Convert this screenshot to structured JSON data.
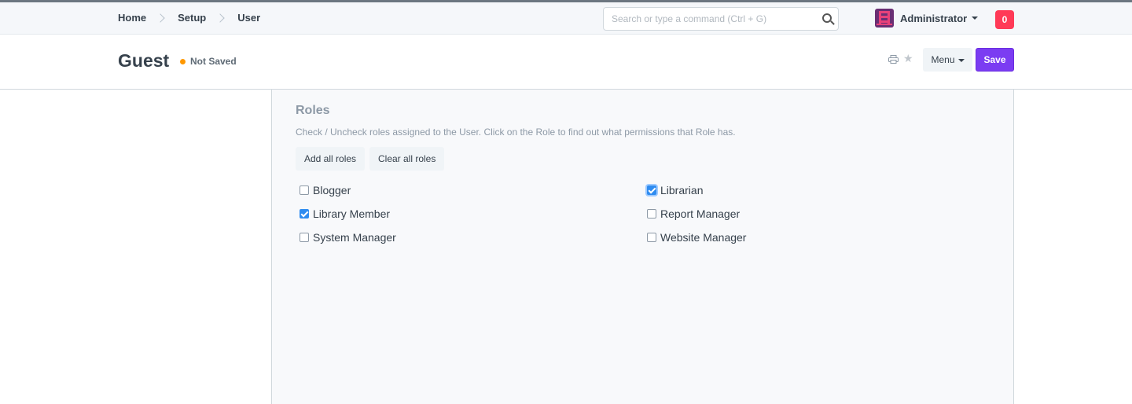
{
  "breadcrumbs": [
    "Home",
    "Setup",
    "User"
  ],
  "search": {
    "placeholder": "Search or type a command (Ctrl + G)",
    "value": ""
  },
  "user": {
    "name": "Administrator"
  },
  "notifications": {
    "count": "0"
  },
  "page": {
    "title": "Guest",
    "status": "Not Saved",
    "status_color": "#ff9800"
  },
  "toolbar": {
    "menu_label": "Menu",
    "save_label": "Save"
  },
  "roles_section": {
    "title": "Roles",
    "description": "Check / Uncheck roles assigned to the User. Click on the Role to find out what permissions that Role has.",
    "add_all_label": "Add all roles",
    "clear_all_label": "Clear all roles",
    "roles": [
      {
        "label": "Blogger",
        "checked": false
      },
      {
        "label": "Librarian",
        "checked": true
      },
      {
        "label": "Library Member",
        "checked": true
      },
      {
        "label": "Report Manager",
        "checked": false
      },
      {
        "label": "System Manager",
        "checked": false
      },
      {
        "label": "Website Manager",
        "checked": false
      }
    ]
  },
  "colors": {
    "primary": "#7b3cf2",
    "notification": "#ff3a57",
    "checkbox_checked": "#2f8cf0"
  }
}
